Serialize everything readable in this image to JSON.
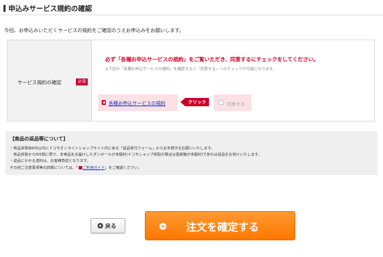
{
  "header": {
    "title": "申込みサービス規約の確認"
  },
  "intro_text": "今回、お申込みいただくサービスの規約をご確認のうえお申込みをお願いします。",
  "terms": {
    "label": "サービス規約の確認",
    "required_badge": "必須",
    "warning": "必ず「各種お申込サービスの規約」をご覧いただき、同意するにチェックをしてください。",
    "note": "※下記の「各種お申込サービスの規約」を確認すると「同意する」へのチェックが可能になります。",
    "link_label": "各種お申込サービスの規約",
    "click_label": "クリック",
    "agree_label": "同意する",
    "agree_checked": false
  },
  "returns": {
    "title": "【商品の返品等について】",
    "line1": "・商品受取後8日以内にドコモオンラインショップサイト内にある「返品受付フォーム」からお手続きをお願いいたします。",
    "line2": "　商品受取から8日間に限り、本商品をお届けしたダンボールが未開封(ドコモショップ受取の場合は個装箱が未開封)であれば返品をお受けいたします。",
    "line3": "・返品にかかる送料は、お客様負担となります。",
    "line4_prefix": "その他ご注意事項等の詳細については、「",
    "line4_link": "ご利用ガイド",
    "line4_suffix": "」をご確認ください。"
  },
  "buttons": {
    "back_label": "戻る",
    "confirm_label": "注文を確定する"
  },
  "colors": {
    "accent_red": "#d6002a",
    "confirm_orange": "#ff8000",
    "link_blue": "#1a3bbf",
    "pink_box": "#fbe0e5"
  }
}
